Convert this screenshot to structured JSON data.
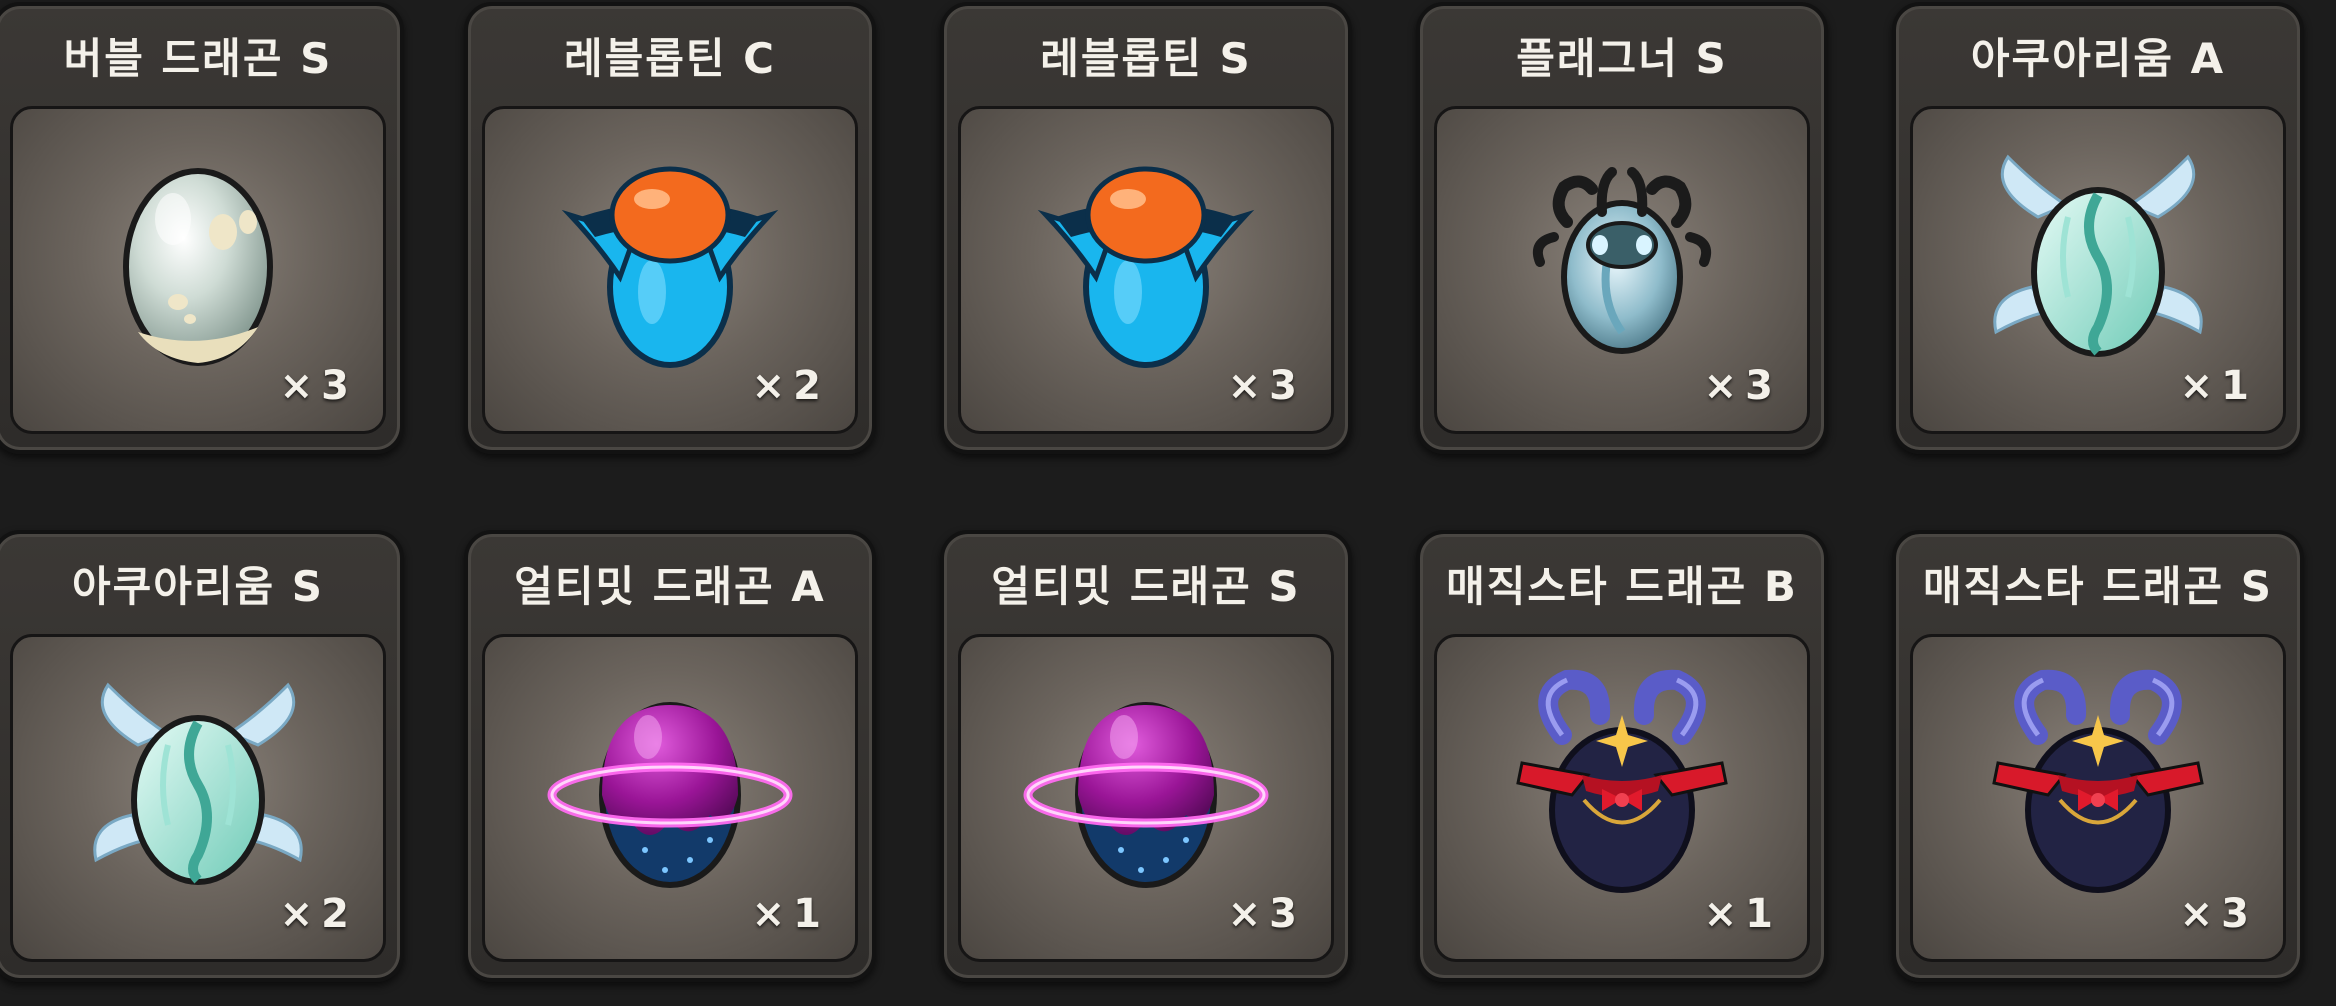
{
  "inventory": {
    "items": [
      {
        "name": "버블 드래곤 S",
        "count": "×3",
        "egg": "bubble-dragon-egg-icon",
        "colors": {
          "shell": "#dfe8e3",
          "spots": "#e8dfbf"
        }
      },
      {
        "name": "레블롭틴 C",
        "count": "×2",
        "egg": "rebloptin-egg-icon",
        "colors": {
          "shell": "#1fb7f0",
          "cap": "#f36a1e"
        }
      },
      {
        "name": "레블롭틴 S",
        "count": "×3",
        "egg": "rebloptin-egg-icon",
        "colors": {
          "shell": "#1fb7f0",
          "cap": "#f36a1e"
        }
      },
      {
        "name": "플래그너 S",
        "count": "×3",
        "egg": "flagner-egg-icon",
        "colors": {
          "shell": "#9fc9d6",
          "horns": "#1b1b1b"
        }
      },
      {
        "name": "아쿠아리움 A",
        "count": "×1",
        "egg": "aquarium-egg-icon",
        "colors": {
          "shell": "#bfe9e1",
          "fins": "#c8e4f4"
        }
      },
      {
        "name": "아쿠아리움 S",
        "count": "×2",
        "egg": "aquarium-egg-icon",
        "colors": {
          "shell": "#bfe9e1",
          "fins": "#c8e4f4"
        }
      },
      {
        "name": "얼티밋 드래곤 A",
        "count": "×1",
        "egg": "ultimate-dragon-egg-icon",
        "colors": {
          "shell": "#a0179c",
          "base": "#123a6a",
          "ring": "#ff6cf0"
        }
      },
      {
        "name": "얼티밋 드래곤 S",
        "count": "×3",
        "egg": "ultimate-dragon-egg-icon",
        "colors": {
          "shell": "#a0179c",
          "base": "#123a6a",
          "ring": "#ff6cf0"
        }
      },
      {
        "name": "매직스타 드래곤 B",
        "count": "×1",
        "egg": "magicstar-dragon-egg-icon",
        "colors": {
          "shell": "#222344",
          "horns": "#5a5cc8",
          "ribbon": "#d8192a"
        }
      },
      {
        "name": "매직스타 드래곤 S",
        "count": "×3",
        "egg": "magicstar-dragon-egg-icon",
        "colors": {
          "shell": "#222344",
          "horns": "#5a5cc8",
          "ribbon": "#d8192a"
        }
      }
    ]
  }
}
